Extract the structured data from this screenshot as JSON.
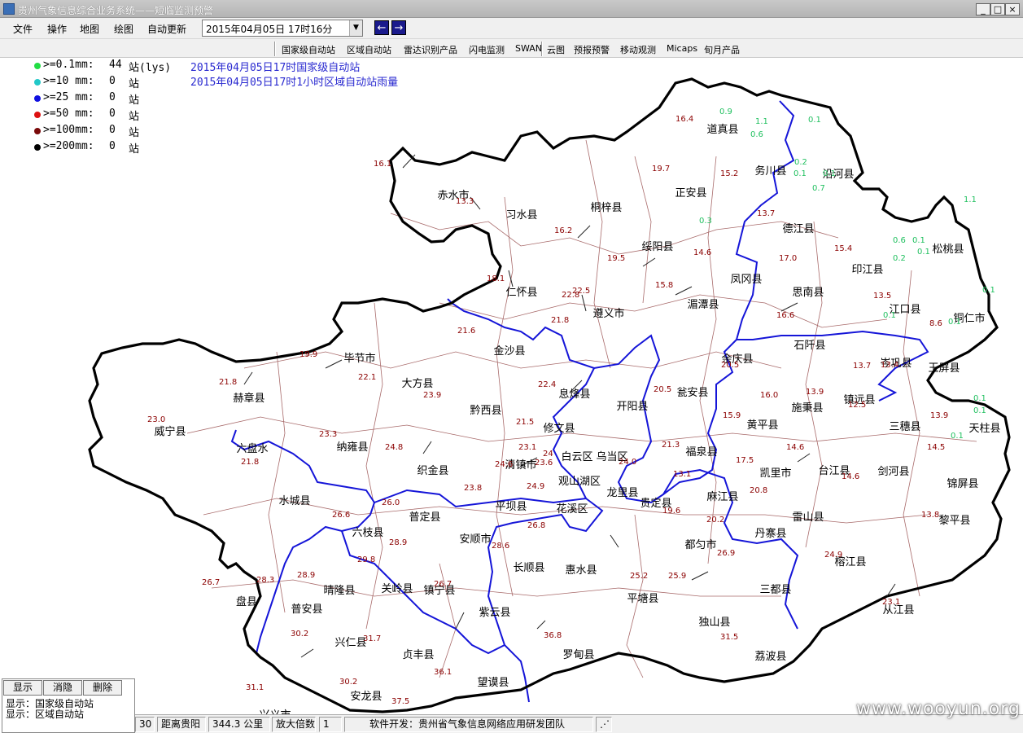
{
  "window": {
    "title": "贵州气象信息综合业务系统——短临监测预警",
    "buttons": [
      "_",
      "□",
      "×"
    ]
  },
  "menu": [
    "文件",
    "操作",
    "地图",
    "绘图",
    "自动更新"
  ],
  "date_select": {
    "value": "2015年04月05日  17时16分"
  },
  "nav": {
    "prev": "←",
    "next": "→"
  },
  "toolbar": [
    "国家级自动站",
    "区域自动站",
    "雷达识别产品",
    "闪电监测",
    "SWAN",
    "云图",
    "预报预警",
    "移动观测",
    "Micaps",
    "旬月产品"
  ],
  "legend": [
    {
      "label": ">=0.1mm:",
      "count": "44",
      "unit": "站(lys)",
      "color": "#22dd44"
    },
    {
      "label": ">=10  mm:",
      "count": "0",
      "unit": "站",
      "color": "#22c8c8"
    },
    {
      "label": ">=25  mm:",
      "count": "0",
      "unit": "站",
      "color": "#1010e0"
    },
    {
      "label": ">=50  mm:",
      "count": "0",
      "unit": "站",
      "color": "#dd1111"
    },
    {
      "label": ">=100mm:",
      "count": "0",
      "unit": "站",
      "color": "#7a0a0a"
    },
    {
      "label": ">=200mm:",
      "count": "0",
      "unit": "站",
      "color": "#000000"
    }
  ],
  "info_lines": [
    "2015年04月05日17时国家级自动站",
    "2015年04月05日17时1小时区域自动站雨量"
  ],
  "counties": [
    "道真县",
    "务川县",
    "沿河县",
    "正安县",
    "赤水市",
    "习水县",
    "桐梓县",
    "绥阳县",
    "德江县",
    "松桃县",
    "印江县",
    "凤冈县",
    "思南县",
    "江口县",
    "铜仁市",
    "仁怀县",
    "遵义市",
    "湄潭县",
    "石阡县",
    "金沙县",
    "毕节市",
    "余庆县",
    "岑巩县",
    "玉屏县",
    "大方县",
    "息烽县",
    "开阳县",
    "瓮安县",
    "镇远县",
    "黔西县",
    "施秉县",
    "赫章县",
    "黄平县",
    "三穗县",
    "天柱县",
    "威宁县",
    "修文县",
    "福泉县",
    "纳雍县",
    "六盘水",
    "清镇市",
    "白云区",
    "乌当区",
    "织金县",
    "观山湖区",
    "凯里市",
    "台江县",
    "剑河县",
    "锦屏县",
    "龙里县",
    "贵定县",
    "麻江县",
    "水城县",
    "普定县",
    "平坝县",
    "花溪区",
    "雷山县",
    "黎平县",
    "六枝县",
    "安顺市",
    "丹寨县",
    "都匀市",
    "长顺县",
    "惠水县",
    "榕江县",
    "关岭县",
    "镇宁县",
    "晴隆县",
    "紫云县",
    "平塘县",
    "三都县",
    "盘县",
    "普安县",
    "独山县",
    "从江县",
    "兴仁县",
    "贞丰县",
    "罗甸县",
    "荔波县",
    "望谟县",
    "安龙县",
    "兴义市"
  ],
  "rain_values": [
    "16.4",
    "0.9",
    "1.1",
    "0.6",
    "0.1",
    "16.1",
    "13.3",
    "19.7",
    "15.2",
    "0.2",
    "0.1",
    "0.7",
    "0.1",
    "13.7",
    "16.2",
    "0.3",
    "1.1",
    "19.5",
    "14.6",
    "17.0",
    "15.4",
    "0.6",
    "0.1",
    "0.2",
    "0.1",
    "18.1",
    "13.5",
    "0.1",
    "0.1",
    "22.5",
    "22.8",
    "15.8",
    "16.6",
    "8.6",
    "0.1",
    "21.8",
    "21.6",
    "19.9",
    "20.5",
    "13.7",
    "13.4",
    "21.8",
    "22.1",
    "22.4",
    "20.5",
    "16.0",
    "13.9",
    "12.5",
    "23.9",
    "15.9",
    "13.9",
    "0.1",
    "0.1",
    "0.1",
    "23.0",
    "21.5",
    "23.3",
    "23.1",
    "21.3",
    "14.6",
    "24.8",
    "21.8",
    "24.6",
    "24",
    "23.6",
    "24.0",
    "17.5",
    "14.5",
    "13.1",
    "14.6",
    "26.0",
    "23.8",
    "24.9",
    "20.8",
    "26.6",
    "26.8",
    "19.6",
    "13.8",
    "20.2",
    "28.9",
    "28.6",
    "26.9",
    "24.9",
    "29.8",
    "25.2",
    "25.9",
    "26.7",
    "28.3",
    "28.9",
    "26.7",
    "23.1",
    "30.2",
    "31.7",
    "36.8",
    "31.5",
    "30.2",
    "36.1",
    "31.1",
    "37.5"
  ],
  "panel": {
    "buttons": [
      "显示",
      "消隐",
      "删除"
    ],
    "lines": [
      "显示：国家级自动站",
      "显示：区域自动站"
    ]
  },
  "status": {
    "value1": "30",
    "distance_label": "距离贵阳",
    "distance_value": "344.3 公里",
    "zoom_label": "放大倍数",
    "zoom_value": "1",
    "developer": "软件开发：贵州省气象信息网络应用研发团队"
  },
  "watermark": "www.wooyun.org"
}
